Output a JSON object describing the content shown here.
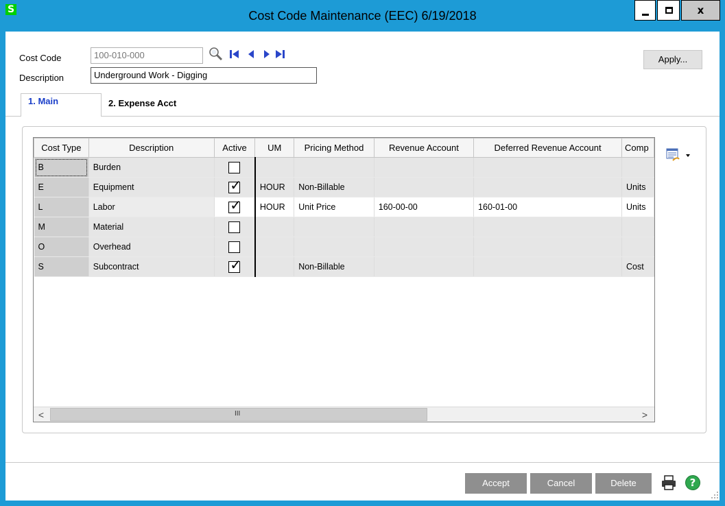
{
  "window": {
    "title": "Cost Code Maintenance (EEC) 6/19/2018",
    "app_icon_letter": "S",
    "minimize_icon": "minimize-icon",
    "maximize_icon": "maximize-icon",
    "close_label": "x"
  },
  "header": {
    "cost_code_label": "Cost Code",
    "cost_code_value": "100-010-000",
    "description_label": "Description",
    "description_value": "Underground Work - Digging",
    "apply_label": "Apply..."
  },
  "tabs": [
    {
      "label": "1. Main",
      "active": true
    },
    {
      "label": "2. Expense Acct",
      "active": false
    }
  ],
  "grid": {
    "columns": [
      "Cost Type",
      "Description",
      "Active",
      "UM",
      "Pricing Method",
      "Revenue Account",
      "Deferred Revenue Account",
      "Comp"
    ],
    "rows": [
      {
        "cost_type": "B",
        "description": "Burden",
        "active": false,
        "um": "",
        "pricing_method": "",
        "revenue_account": "",
        "deferred_revenue_account": "",
        "comp": ""
      },
      {
        "cost_type": "E",
        "description": "Equipment",
        "active": true,
        "um": "HOUR",
        "pricing_method": "Non-Billable",
        "revenue_account": "",
        "deferred_revenue_account": "",
        "comp": "Units"
      },
      {
        "cost_type": "L",
        "description": "Labor",
        "active": true,
        "um": "HOUR",
        "pricing_method": "Unit Price",
        "revenue_account": "160-00-00",
        "deferred_revenue_account": "160-01-00",
        "comp": "Units"
      },
      {
        "cost_type": "M",
        "description": "Material",
        "active": false,
        "um": "",
        "pricing_method": "",
        "revenue_account": "",
        "deferred_revenue_account": "",
        "comp": ""
      },
      {
        "cost_type": "O",
        "description": "Overhead",
        "active": false,
        "um": "",
        "pricing_method": "",
        "revenue_account": "",
        "deferred_revenue_account": "",
        "comp": ""
      },
      {
        "cost_type": "S",
        "description": "Subcontract",
        "active": true,
        "um": "",
        "pricing_method": "Non-Billable",
        "revenue_account": "",
        "deferred_revenue_account": "",
        "comp": "Cost"
      }
    ],
    "scroll_left": "<",
    "scroll_right": ">",
    "scroll_grip": "III"
  },
  "footer": {
    "accept_label": "Accept",
    "cancel_label": "Cancel",
    "delete_label": "Delete"
  },
  "colors": {
    "title_bar": "#1d9bd6",
    "active_tab_text": "#1a3ec9",
    "action_button": "#8f8f8f",
    "help_icon": "#2fa84f"
  }
}
